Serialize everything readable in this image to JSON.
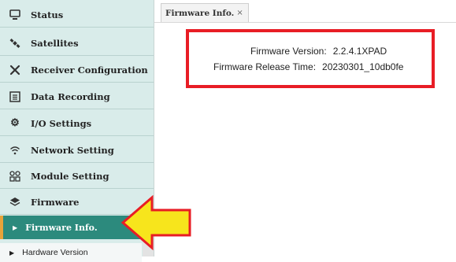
{
  "sidebar": {
    "items": [
      {
        "label": "Status",
        "icon": "monitor-icon"
      },
      {
        "label": "Satellites",
        "icon": "satellite-icon"
      },
      {
        "label": "Receiver Configuration",
        "icon": "tools-icon"
      },
      {
        "label": "Data Recording",
        "icon": "list-icon"
      },
      {
        "label": "I/O Settings",
        "icon": "gear-icon"
      },
      {
        "label": "Network Setting",
        "icon": "wifi-icon"
      },
      {
        "label": "Module Setting",
        "icon": "modules-icon"
      },
      {
        "label": "Firmware",
        "icon": "layers-icon"
      }
    ],
    "sub_items": [
      {
        "label": "Firmware Info.",
        "active": true
      },
      {
        "label": "Hardware Version",
        "active": false
      }
    ]
  },
  "tabs": [
    {
      "label": "Firmware Info.",
      "close": "×"
    }
  ],
  "firmware": {
    "version_label": "Firmware Version:",
    "version_value": "2.2.4.1XPAD",
    "release_label": "Firmware Release Time:",
    "release_value": "20230301_10db0fe"
  },
  "colors": {
    "sidebar_bg": "#d9ecea",
    "active_bg": "#2c8a7d",
    "highlight_border": "#e81d25",
    "arrow_fill": "#f7e51c"
  }
}
